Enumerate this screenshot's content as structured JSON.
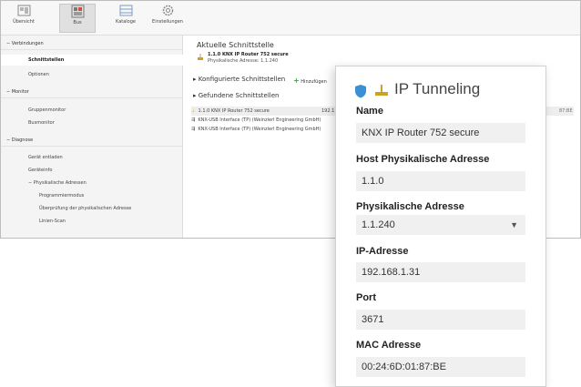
{
  "toolbar": {
    "items": [
      {
        "label": "Übersicht",
        "icon": "overview-icon"
      },
      {
        "label": "Bus",
        "icon": "bus-icon"
      },
      {
        "label": "Kataloge",
        "icon": "catalog-icon"
      },
      {
        "label": "Einstellungen",
        "icon": "gear-icon"
      }
    ]
  },
  "sidebar": {
    "sections": {
      "verbindungen": "Verbindungen",
      "monitor": "Monitor",
      "diagnose": "Diagnose"
    },
    "items": {
      "schnittstellen": "Schnittstellen",
      "optionen": "Optionen",
      "gruppenmonitor": "Gruppenmonitor",
      "busmonitor": "Busmonitor",
      "geraet_entladen": "Gerät entladen",
      "geraeteinfo": "Geräteinfo",
      "phys_adressen": "Physikalische Adressen",
      "programmiermodus": "Programmiermodus",
      "ueberpruefung": "Überprüfung der physikalischen Adresse",
      "linien_scan": "Linien-Scan"
    }
  },
  "content": {
    "current_title": "Aktuelle Schnittstelle",
    "current_name": "1.1.0 KNX IP Router 752 secure",
    "current_addr": "Physikalische Adresse: 1.1.240",
    "configured": "Konfigurierte Schnittstellen",
    "add": "Hinzufügen",
    "found": "Gefundene Schnittstellen",
    "rows": [
      {
        "text": "1.1.0 KNX IP Router 752 secure",
        "ip": "192.1",
        "suffix": "87:BE"
      },
      {
        "text": "KNX-USB Interface (TP) (Weinzierl Engineering GmbH)"
      },
      {
        "text": "KNX-USB Interface (TP) (Weinzierl Engineering GmbH)"
      }
    ]
  },
  "panel": {
    "title": "IP Tunneling",
    "fields": {
      "name_label": "Name",
      "name_value": "KNX IP Router 752 secure",
      "host_label": "Host Physikalische Adresse",
      "host_value": "1.1.0",
      "phys_label": "Physikalische Adresse",
      "phys_value": "1.1.240",
      "ip_label": "IP-Adresse",
      "ip_value": "192.168.1.31",
      "port_label": "Port",
      "port_value": "3671",
      "mac_label": "MAC Adresse",
      "mac_value": "00:24:6D:01:87:BE"
    }
  },
  "colors": {
    "shield": "#3b8fd4",
    "router_icon": "#c9a227",
    "add_plus": "#3aa63a"
  }
}
